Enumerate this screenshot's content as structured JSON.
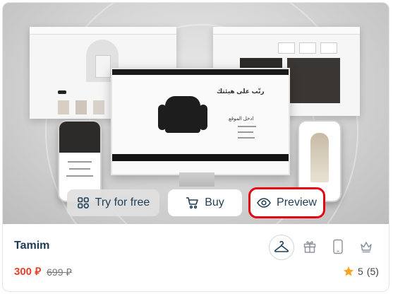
{
  "product": {
    "title": "Tamim",
    "price": "300",
    "currency": "⃁",
    "old_price": "699",
    "rating": "5",
    "rating_count": "(5)"
  },
  "actions": {
    "try_label": "Try for free",
    "buy_label": "Buy",
    "preview_label": "Preview"
  },
  "preview_screens": {
    "monitor_heading": "رتّب على هيئتك",
    "monitor_sub": "ادخل الموقع"
  },
  "icons": [
    "hanger-icon",
    "gift-icon",
    "mobile-icon",
    "crown-icon",
    "star-icon",
    "eye-icon",
    "cart-icon",
    "grid-icon"
  ],
  "colors": {
    "primary": "#1b3d55",
    "price": "#e8412c",
    "star": "#f5a623",
    "highlight": "#e30613"
  }
}
